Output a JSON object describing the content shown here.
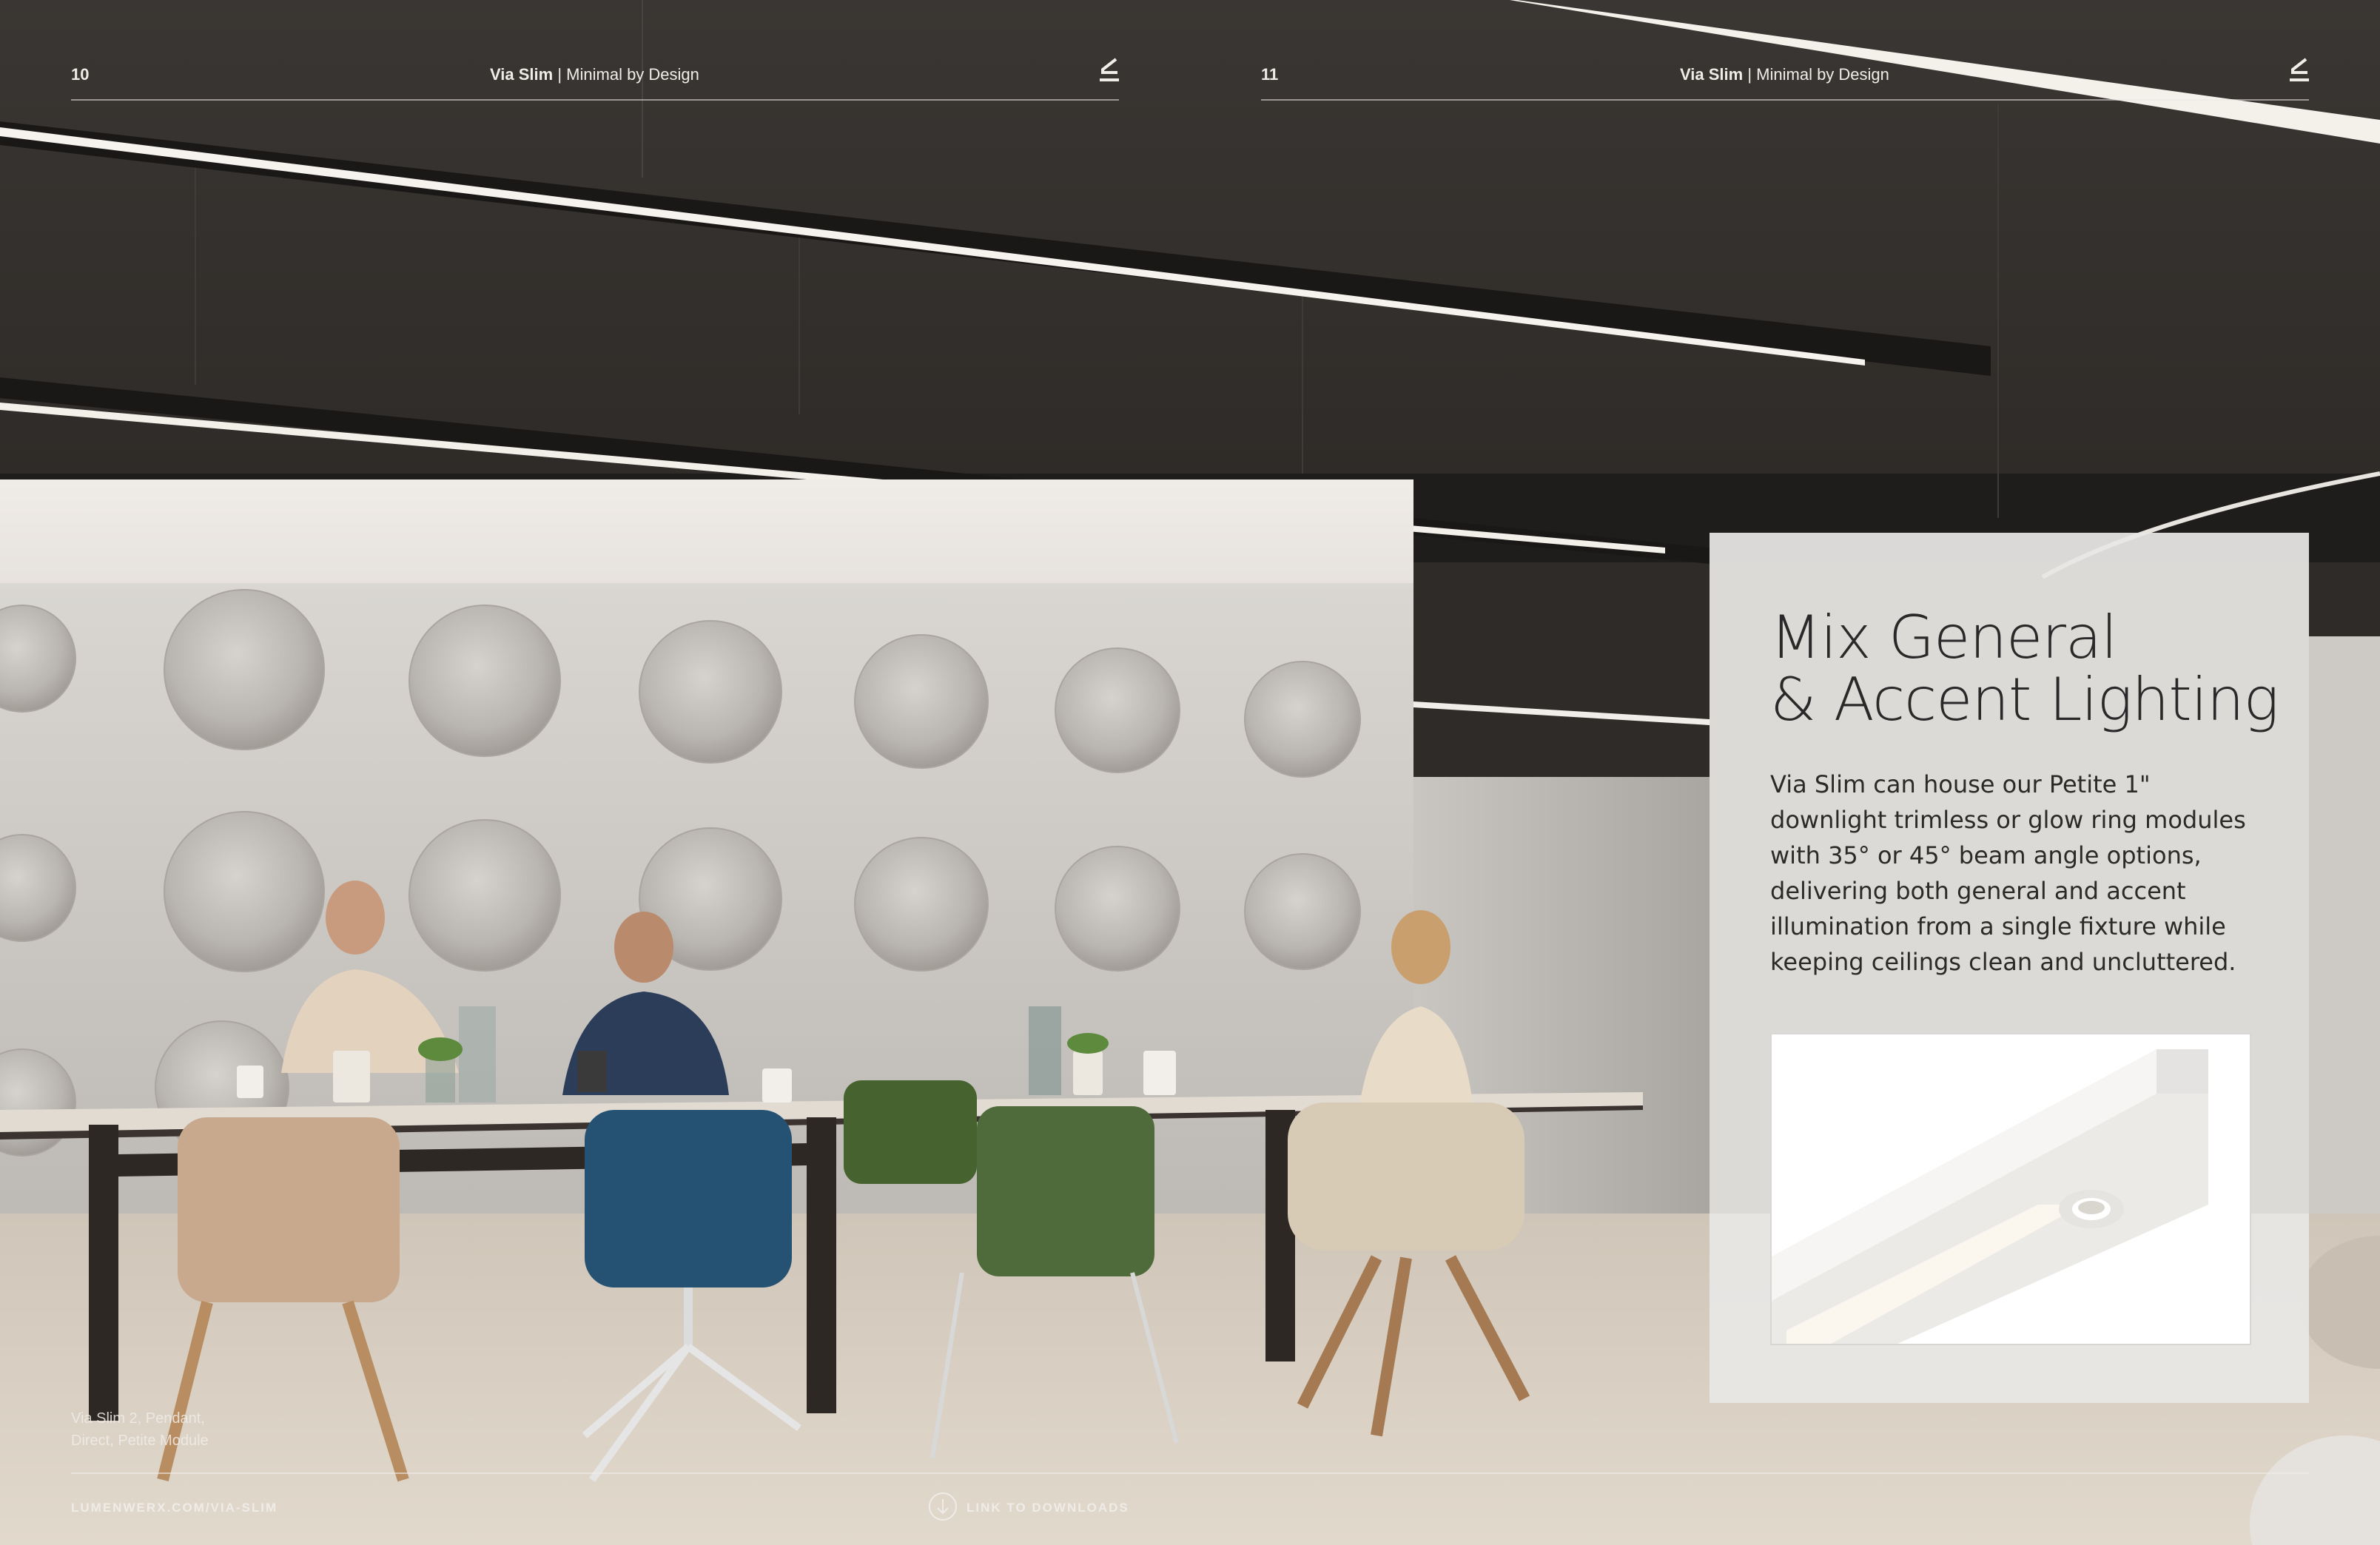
{
  "header": {
    "left_page_number": "10",
    "right_page_number": "11",
    "product_name": "Via Slim",
    "separator": "|",
    "tagline": "Minimal by Design"
  },
  "card": {
    "title_line1": "Mix General",
    "title_line2": "& Accent Lighting",
    "body": "Via Slim can house our Petite 1\" downlight trimless or glow ring modules with 35° or 45° beam angle options, delivering both general and accent illumination from a single fixture while keeping ceilings clean and uncluttered."
  },
  "caption": {
    "line1": "Via Slim 2, Pendant,",
    "line2": "Direct, Petite Module"
  },
  "footer": {
    "url": "LUMENWERX.COM/VIA-SLIM",
    "downloads_link": "LINK TO DOWNLOADS"
  },
  "icons": {
    "logo": "lumenwerx-logo-icon",
    "download": "download-arrow-icon"
  },
  "colors": {
    "ceiling": "#2e2b28",
    "wall": "#cfccc8",
    "floor": "#d9cfc3",
    "card": "#e8e7e5"
  }
}
